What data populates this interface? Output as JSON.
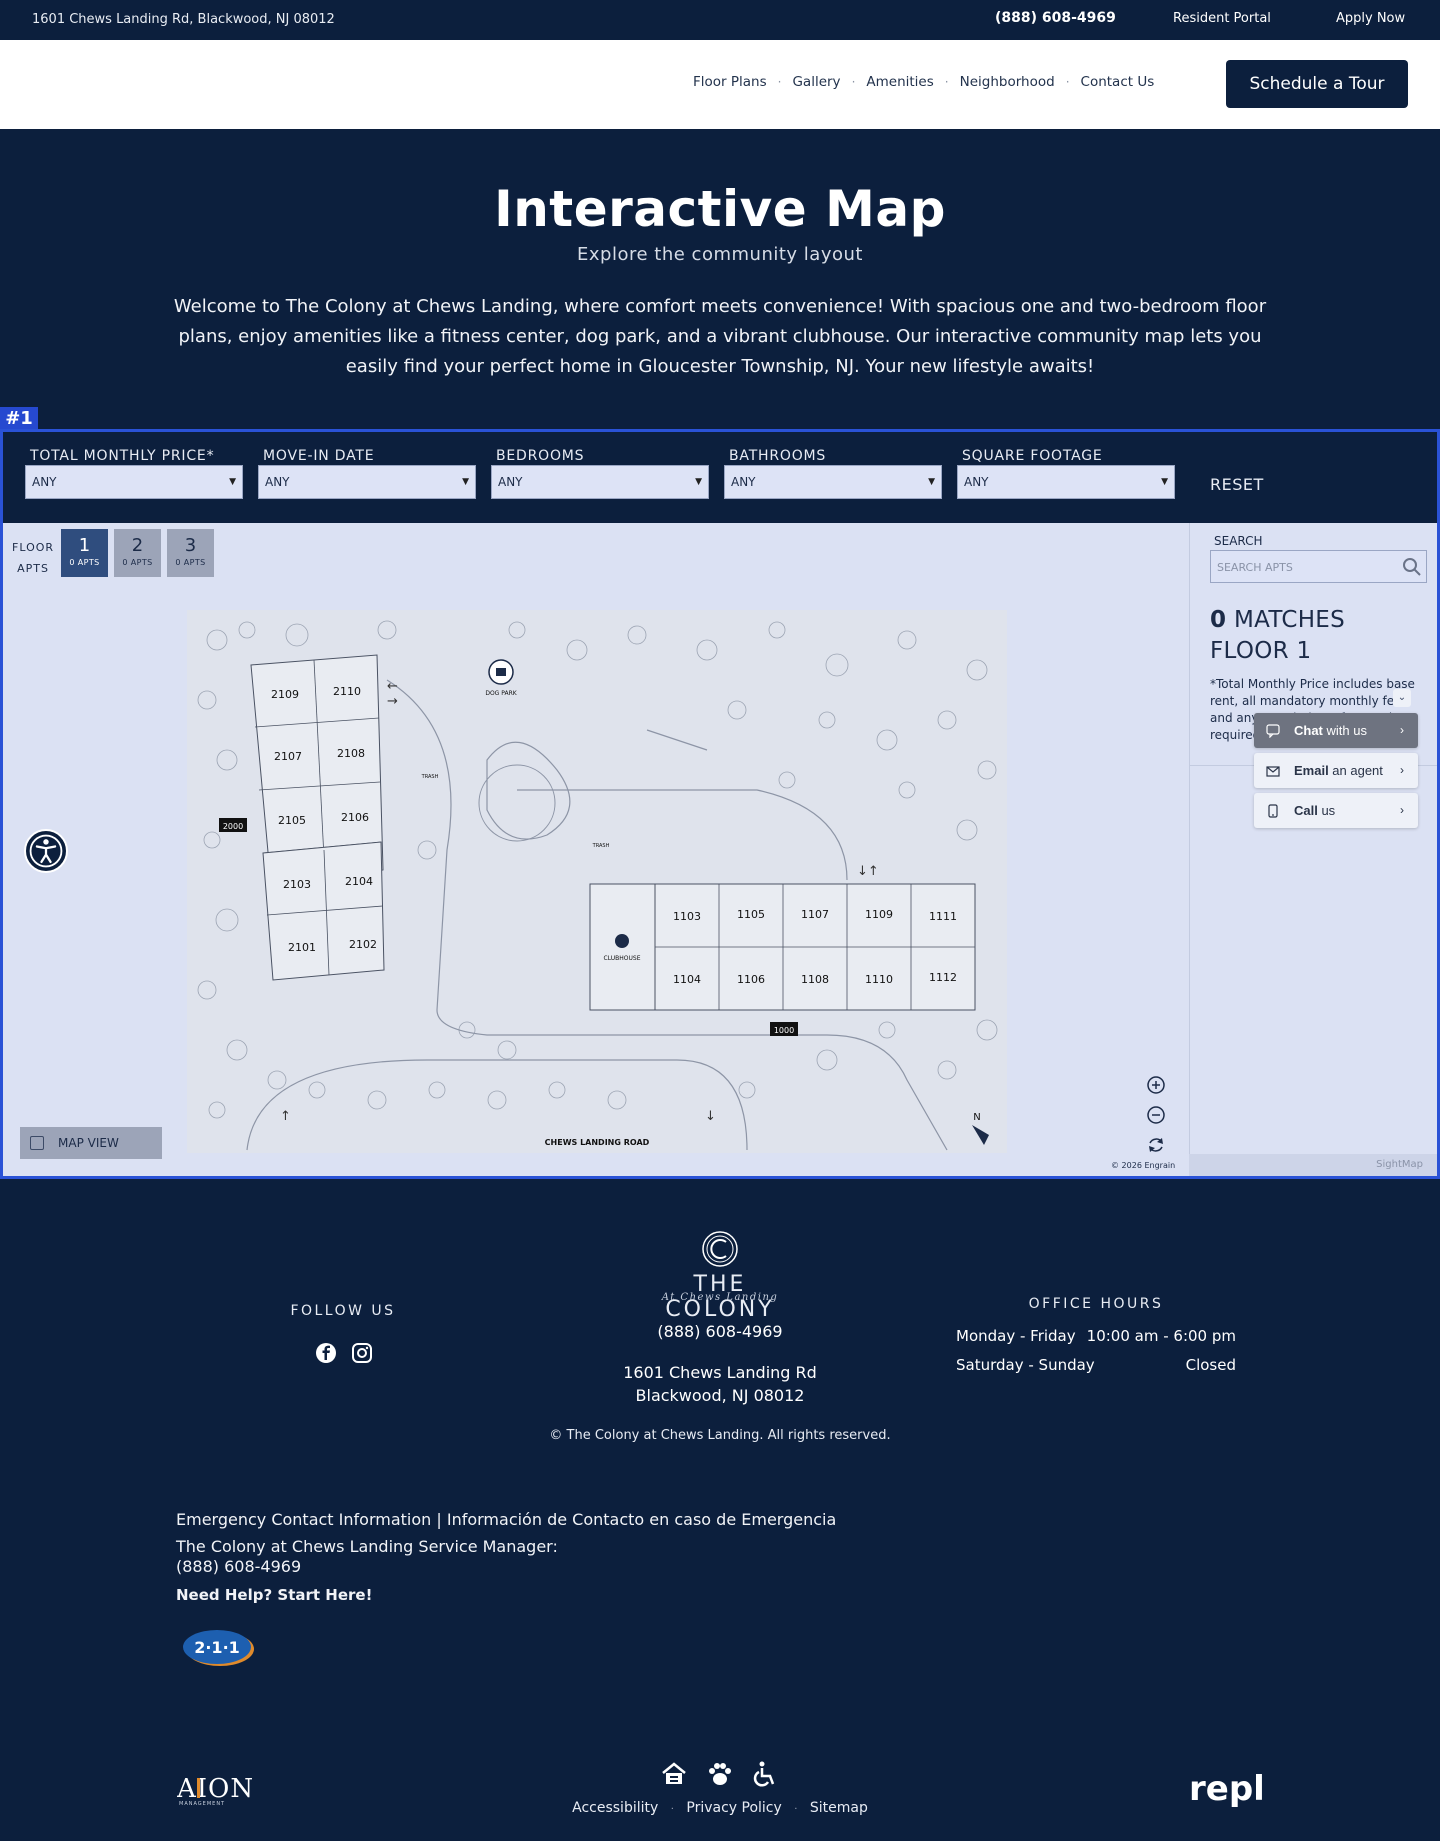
{
  "topbar": {
    "address": "1601 Chews Landing Rd, Blackwood, NJ 08012",
    "phone": "(888) 608-4969",
    "resident_portal": "Resident Portal",
    "apply_now": "Apply Now"
  },
  "nav": {
    "links": [
      "Floor Plans",
      "Gallery",
      "Amenities",
      "Neighborhood",
      "Contact Us"
    ],
    "separator": "·",
    "cta": "Schedule a Tour"
  },
  "hero": {
    "title": "Interactive Map",
    "subtitle": "Explore the community layout",
    "description": "Welcome to The Colony at Chews Landing, where comfort meets convenience! With spacious one and two-bedroom floor plans, enjoy amenities like a fitness center, dog park, and a vibrant clubhouse. Our interactive community map lets you easily find your perfect home in Gloucester Township, NJ. Your new lifestyle awaits!"
  },
  "widget_tag": "#1",
  "filters": {
    "items": [
      {
        "label": "TOTAL MONTHLY PRICE*",
        "value": "ANY"
      },
      {
        "label": "MOVE-IN DATE",
        "value": "ANY"
      },
      {
        "label": "BEDROOMS",
        "value": "ANY"
      },
      {
        "label": "BATHROOMS",
        "value": "ANY"
      },
      {
        "label": "SQUARE FOOTAGE",
        "value": "ANY"
      }
    ],
    "reset": "RESET"
  },
  "floors": {
    "label_line1": "FLOOR",
    "label_line2": "APTS",
    "items": [
      {
        "number": "1",
        "apts": "0 APTS",
        "active": true
      },
      {
        "number": "2",
        "apts": "0 APTS",
        "active": false
      },
      {
        "number": "3",
        "apts": "0 APTS",
        "active": false
      }
    ]
  },
  "map": {
    "building_2000_label": "2000",
    "building_1000_label": "1000",
    "units_2000": [
      "2109",
      "2110",
      "2107",
      "2108",
      "2105",
      "2106",
      "2103",
      "2104",
      "2101",
      "2102"
    ],
    "units_1000_top": [
      "1103",
      "1105",
      "1107",
      "1109",
      "1111"
    ],
    "units_1000_bottom": [
      "1104",
      "1106",
      "1108",
      "1110",
      "1112"
    ],
    "dog_park": "DOG PARK",
    "clubhouse": "CLUBHOUSE",
    "trash": "TRASH",
    "road": "CHEWS LANDING ROAD",
    "north": "N",
    "map_view": "MAP VIEW",
    "copyright": "© 2026 Engrain",
    "zoom_icons": [
      "zoom-in-icon",
      "zoom-out-icon",
      "reset-view-icon"
    ]
  },
  "side": {
    "search_label": "SEARCH",
    "search_placeholder": "SEARCH APTS",
    "match_count": "0",
    "matches_word": "MATCHES",
    "floor": "FLOOR 1",
    "note": "*Total Monthly Price includes base rent, all mandatory monthly fees and any... Excludes... fees and required charges due at or prior to",
    "sightmap": "SightMap"
  },
  "chat": {
    "items": [
      {
        "bold": "Chat",
        "rest": " with us"
      },
      {
        "bold": "Email",
        "rest": " an agent"
      },
      {
        "bold": "Call",
        "rest": " us"
      }
    ],
    "chevron": "›",
    "minimize": "⌄"
  },
  "footer": {
    "follow_us": "FOLLOW US",
    "brand": "THE COLONY",
    "brand_sub": "At Chews Landing",
    "phone": "(888) 608-4969",
    "address_line1": "1601 Chews Landing Rd",
    "address_line2": "Blackwood, NJ 08012",
    "copyright": "© The Colony at Chews Landing. All rights reserved.",
    "hours_title": "OFFICE HOURS",
    "hours": [
      {
        "days": "Monday - Friday",
        "time": "10:00 am - 6:00 pm"
      },
      {
        "days": "Saturday - Sunday",
        "time": "Closed"
      }
    ],
    "emergency_title": "Emergency Contact Information | Información de Contacto en caso de Emergencia",
    "service_manager": "The Colony at Chews Landing Service Manager:",
    "service_phone": "(888) 608-4969",
    "need_help": "Need Help? Start Here!",
    "badge_211": "2·1·1",
    "aion": "AION",
    "aion_sub": "MANAGEMENT",
    "repli": "repli",
    "bottom_links": [
      "Accessibility",
      "Privacy Policy",
      "Sitemap"
    ]
  },
  "colors": {
    "navy": "#0c1f3d",
    "widget_border": "#2a52d6",
    "map_bg": "#dbe1f3",
    "floor_active": "#2f4d7e"
  }
}
